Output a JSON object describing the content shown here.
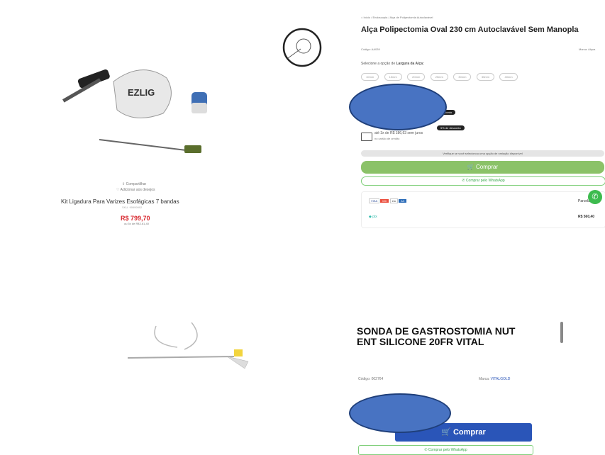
{
  "panel1": {
    "share": "Compartilhar",
    "add_wishlist": "Adicionar aos desejos",
    "product_title": "Kit Ligadura Para Varizes Esofágicas 7 bandas",
    "sku": "SKU: 99999992",
    "price": "R$ 799,70",
    "installments": "ou 5x de R$ 161,40",
    "product_logo": "EZLIG"
  },
  "panel2": {
    "breadcrumb": "Início / Endoscopia / Alça de Polipectomia Autoclavável",
    "title": "Alça Polipectomia Oval 230 cm Autoclavável Sem Manopla",
    "code": "Código: AA039",
    "brand": "Marca: Alqua",
    "select_label": "Selecione a opção de",
    "select_bold": "Largura da Alça:",
    "sizes": [
      "10mm",
      "15mm",
      "20mm",
      "25mm",
      "30mm",
      "35mm",
      "40mm"
    ],
    "installments_text": "até 3x de R$ 186,63 sem juros",
    "installments_sub": "no cartão de crédito",
    "warning": "Verifique se você selecionou uma opção de variação disponível",
    "buy": "Comprar",
    "whatsapp": "Comprar pelo WhatsApp",
    "payment_right": "Parcelas",
    "pix_label": "pix",
    "pix_price": "R$ 560,40",
    "badge1": "desconto",
    "badge2": "5% de desconto"
  },
  "panel4": {
    "title": "SONDA DE GASTROSTOMIA NUT ENT SILICONE 20FR VITAL",
    "code_label": "Código: 002764",
    "brand_label": "Marca:",
    "brand_value": "VITALGOLD",
    "buy": "Comprar",
    "whatsapp": "Comprar pelo WhatsApp"
  },
  "colors": {
    "accent_green": "#8bc268",
    "price_red": "#d8262c",
    "buy_blue": "#2a55b8",
    "circle_blue": "#4873c2"
  }
}
